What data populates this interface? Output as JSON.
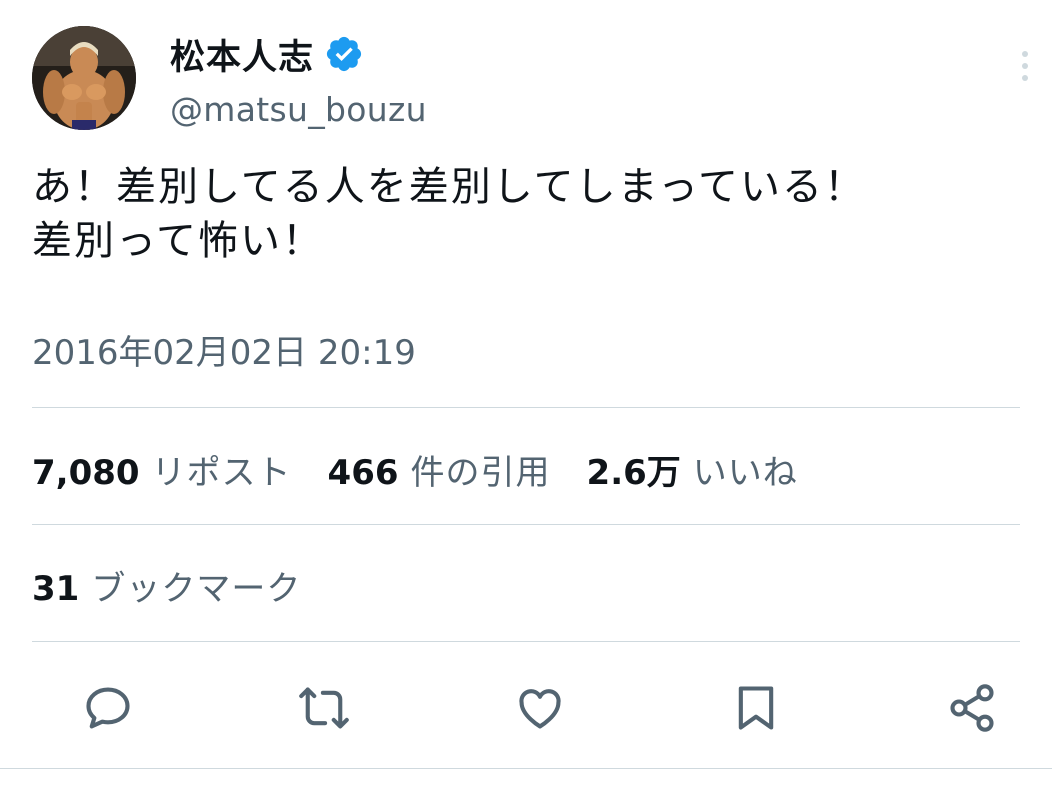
{
  "author": {
    "display_name": "松本人志",
    "handle": "@matsu_bouzu",
    "verified": true,
    "avatar_icon": "avatar-muscle-figure"
  },
  "tweet": {
    "lines": [
      "あ！差別してる人を差別してしまっている！",
      "差別って怖い！"
    ],
    "timestamp": "2016年02月02日 20:19"
  },
  "stats": {
    "reposts": {
      "count": "7,080",
      "label": "リポスト"
    },
    "quotes": {
      "count": "466",
      "label": "件の引用"
    },
    "likes": {
      "count": "2.6万",
      "label": "いいね"
    },
    "bookmarks": {
      "count": "31",
      "label": "ブックマーク"
    }
  },
  "actions": [
    "reply-icon",
    "repost-icon",
    "like-icon",
    "bookmark-icon",
    "share-icon"
  ],
  "colors": {
    "text_primary": "#0f1419",
    "text_secondary": "#536471",
    "divider": "#cfd9de",
    "verified_blue": "#1d9bf0"
  }
}
